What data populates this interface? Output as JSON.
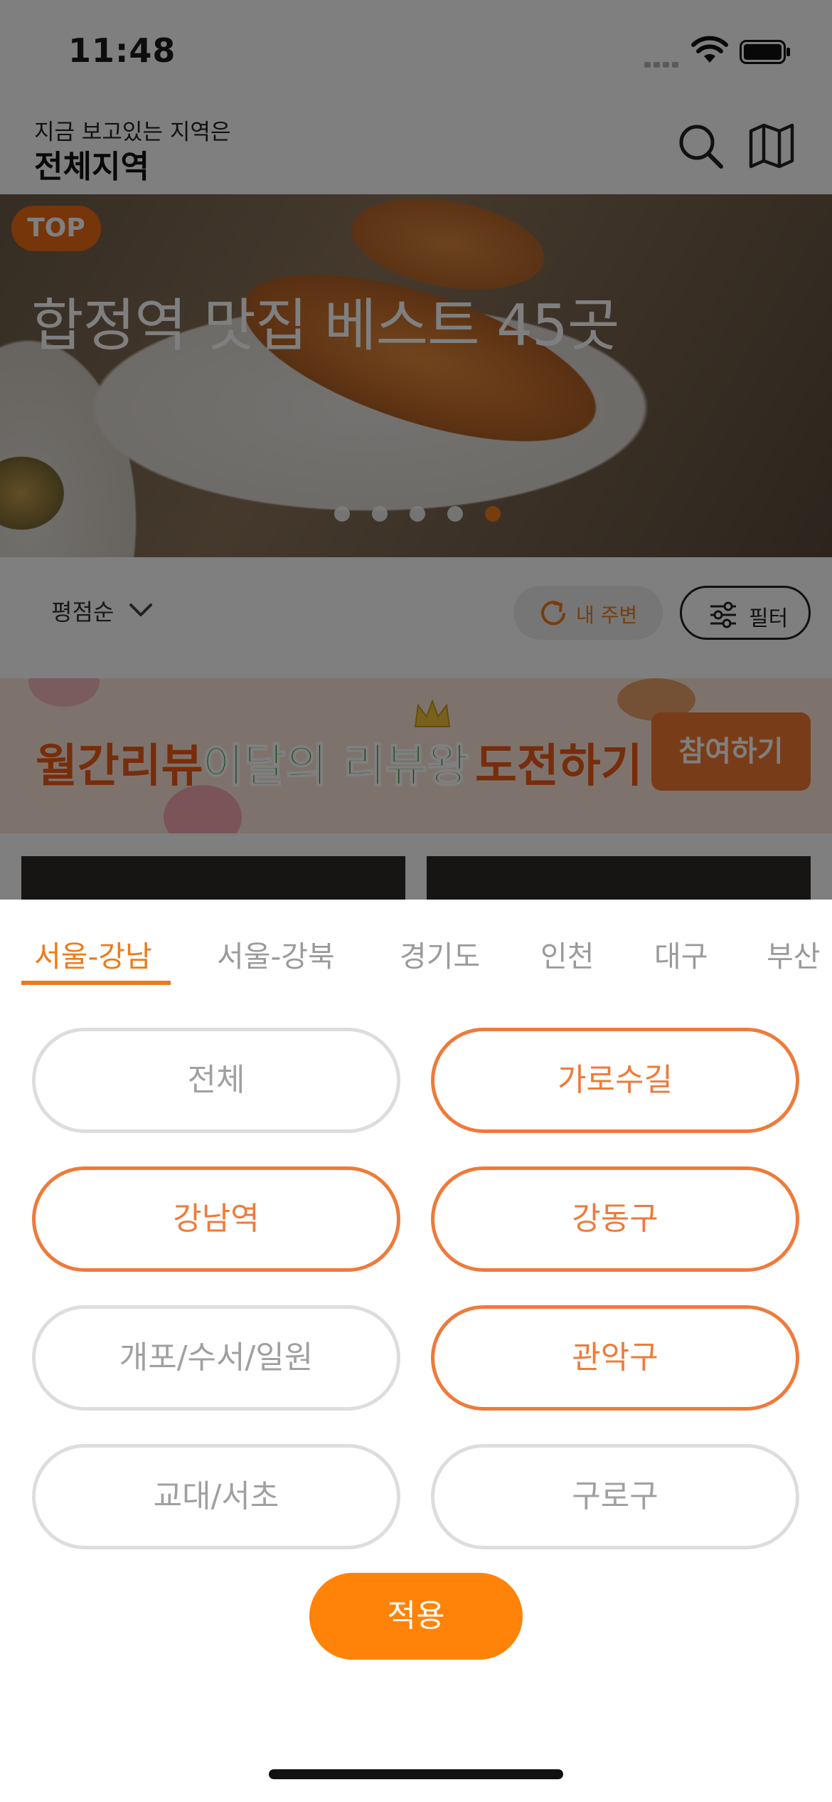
{
  "status_bar": {
    "time": "11:48"
  },
  "header": {
    "caption": "지금 보고있는 지역은",
    "region": "전체지역"
  },
  "banner": {
    "badge": "TOP",
    "title": "합정역 맛집 베스트 45곳",
    "page_count": 5,
    "active_page": 5
  },
  "sort_bar": {
    "sort_label": "평점순",
    "nearby_label": "내 주변",
    "filter_label": "필터"
  },
  "promo": {
    "text_a": "월간리뷰",
    "text_b": "이달의 리뷰왕",
    "text_c": "도전하기",
    "button": "참여하기"
  },
  "sheet": {
    "tabs": [
      {
        "label": "서울-강남",
        "active": true
      },
      {
        "label": "서울-강북",
        "active": false
      },
      {
        "label": "경기도",
        "active": false
      },
      {
        "label": "인천",
        "active": false
      },
      {
        "label": "대구",
        "active": false
      },
      {
        "label": "부산",
        "active": false
      }
    ],
    "chips": [
      {
        "label": "전체",
        "selected": false
      },
      {
        "label": "가로수길",
        "selected": true
      },
      {
        "label": "강남역",
        "selected": true
      },
      {
        "label": "강동구",
        "selected": true
      },
      {
        "label": "개포/수서/일원",
        "selected": false
      },
      {
        "label": "관악구",
        "selected": true
      },
      {
        "label": "교대/서초",
        "selected": false
      },
      {
        "label": "구로구",
        "selected": false
      }
    ],
    "apply_label": "적용"
  },
  "colors": {
    "accent": "#ef7a1a",
    "apply": "#ff8308",
    "chip_selected": "#ef7a3a",
    "chip_default": "#dddddd"
  }
}
